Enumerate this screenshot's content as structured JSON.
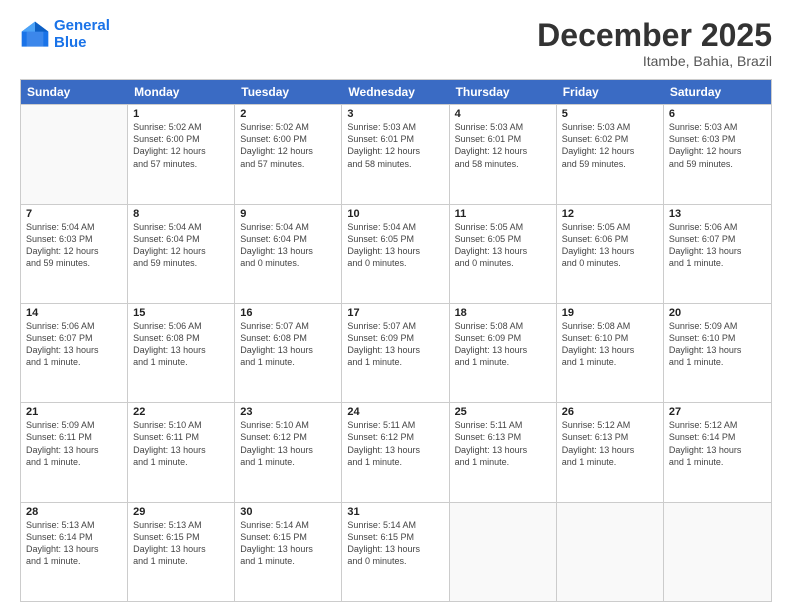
{
  "logo": {
    "line1": "General",
    "line2": "Blue"
  },
  "title": "December 2025",
  "subtitle": "Itambe, Bahia, Brazil",
  "header_days": [
    "Sunday",
    "Monday",
    "Tuesday",
    "Wednesday",
    "Thursday",
    "Friday",
    "Saturday"
  ],
  "rows": [
    [
      {
        "day": "",
        "info": ""
      },
      {
        "day": "1",
        "info": "Sunrise: 5:02 AM\nSunset: 6:00 PM\nDaylight: 12 hours\nand 57 minutes."
      },
      {
        "day": "2",
        "info": "Sunrise: 5:02 AM\nSunset: 6:00 PM\nDaylight: 12 hours\nand 57 minutes."
      },
      {
        "day": "3",
        "info": "Sunrise: 5:03 AM\nSunset: 6:01 PM\nDaylight: 12 hours\nand 58 minutes."
      },
      {
        "day": "4",
        "info": "Sunrise: 5:03 AM\nSunset: 6:01 PM\nDaylight: 12 hours\nand 58 minutes."
      },
      {
        "day": "5",
        "info": "Sunrise: 5:03 AM\nSunset: 6:02 PM\nDaylight: 12 hours\nand 59 minutes."
      },
      {
        "day": "6",
        "info": "Sunrise: 5:03 AM\nSunset: 6:03 PM\nDaylight: 12 hours\nand 59 minutes."
      }
    ],
    [
      {
        "day": "7",
        "info": "Sunrise: 5:04 AM\nSunset: 6:03 PM\nDaylight: 12 hours\nand 59 minutes."
      },
      {
        "day": "8",
        "info": "Sunrise: 5:04 AM\nSunset: 6:04 PM\nDaylight: 12 hours\nand 59 minutes."
      },
      {
        "day": "9",
        "info": "Sunrise: 5:04 AM\nSunset: 6:04 PM\nDaylight: 13 hours\nand 0 minutes."
      },
      {
        "day": "10",
        "info": "Sunrise: 5:04 AM\nSunset: 6:05 PM\nDaylight: 13 hours\nand 0 minutes."
      },
      {
        "day": "11",
        "info": "Sunrise: 5:05 AM\nSunset: 6:05 PM\nDaylight: 13 hours\nand 0 minutes."
      },
      {
        "day": "12",
        "info": "Sunrise: 5:05 AM\nSunset: 6:06 PM\nDaylight: 13 hours\nand 0 minutes."
      },
      {
        "day": "13",
        "info": "Sunrise: 5:06 AM\nSunset: 6:07 PM\nDaylight: 13 hours\nand 1 minute."
      }
    ],
    [
      {
        "day": "14",
        "info": "Sunrise: 5:06 AM\nSunset: 6:07 PM\nDaylight: 13 hours\nand 1 minute."
      },
      {
        "day": "15",
        "info": "Sunrise: 5:06 AM\nSunset: 6:08 PM\nDaylight: 13 hours\nand 1 minute."
      },
      {
        "day": "16",
        "info": "Sunrise: 5:07 AM\nSunset: 6:08 PM\nDaylight: 13 hours\nand 1 minute."
      },
      {
        "day": "17",
        "info": "Sunrise: 5:07 AM\nSunset: 6:09 PM\nDaylight: 13 hours\nand 1 minute."
      },
      {
        "day": "18",
        "info": "Sunrise: 5:08 AM\nSunset: 6:09 PM\nDaylight: 13 hours\nand 1 minute."
      },
      {
        "day": "19",
        "info": "Sunrise: 5:08 AM\nSunset: 6:10 PM\nDaylight: 13 hours\nand 1 minute."
      },
      {
        "day": "20",
        "info": "Sunrise: 5:09 AM\nSunset: 6:10 PM\nDaylight: 13 hours\nand 1 minute."
      }
    ],
    [
      {
        "day": "21",
        "info": "Sunrise: 5:09 AM\nSunset: 6:11 PM\nDaylight: 13 hours\nand 1 minute."
      },
      {
        "day": "22",
        "info": "Sunrise: 5:10 AM\nSunset: 6:11 PM\nDaylight: 13 hours\nand 1 minute."
      },
      {
        "day": "23",
        "info": "Sunrise: 5:10 AM\nSunset: 6:12 PM\nDaylight: 13 hours\nand 1 minute."
      },
      {
        "day": "24",
        "info": "Sunrise: 5:11 AM\nSunset: 6:12 PM\nDaylight: 13 hours\nand 1 minute."
      },
      {
        "day": "25",
        "info": "Sunrise: 5:11 AM\nSunset: 6:13 PM\nDaylight: 13 hours\nand 1 minute."
      },
      {
        "day": "26",
        "info": "Sunrise: 5:12 AM\nSunset: 6:13 PM\nDaylight: 13 hours\nand 1 minute."
      },
      {
        "day": "27",
        "info": "Sunrise: 5:12 AM\nSunset: 6:14 PM\nDaylight: 13 hours\nand 1 minute."
      }
    ],
    [
      {
        "day": "28",
        "info": "Sunrise: 5:13 AM\nSunset: 6:14 PM\nDaylight: 13 hours\nand 1 minute."
      },
      {
        "day": "29",
        "info": "Sunrise: 5:13 AM\nSunset: 6:15 PM\nDaylight: 13 hours\nand 1 minute."
      },
      {
        "day": "30",
        "info": "Sunrise: 5:14 AM\nSunset: 6:15 PM\nDaylight: 13 hours\nand 1 minute."
      },
      {
        "day": "31",
        "info": "Sunrise: 5:14 AM\nSunset: 6:15 PM\nDaylight: 13 hours\nand 0 minutes."
      },
      {
        "day": "",
        "info": ""
      },
      {
        "day": "",
        "info": ""
      },
      {
        "day": "",
        "info": ""
      }
    ]
  ]
}
